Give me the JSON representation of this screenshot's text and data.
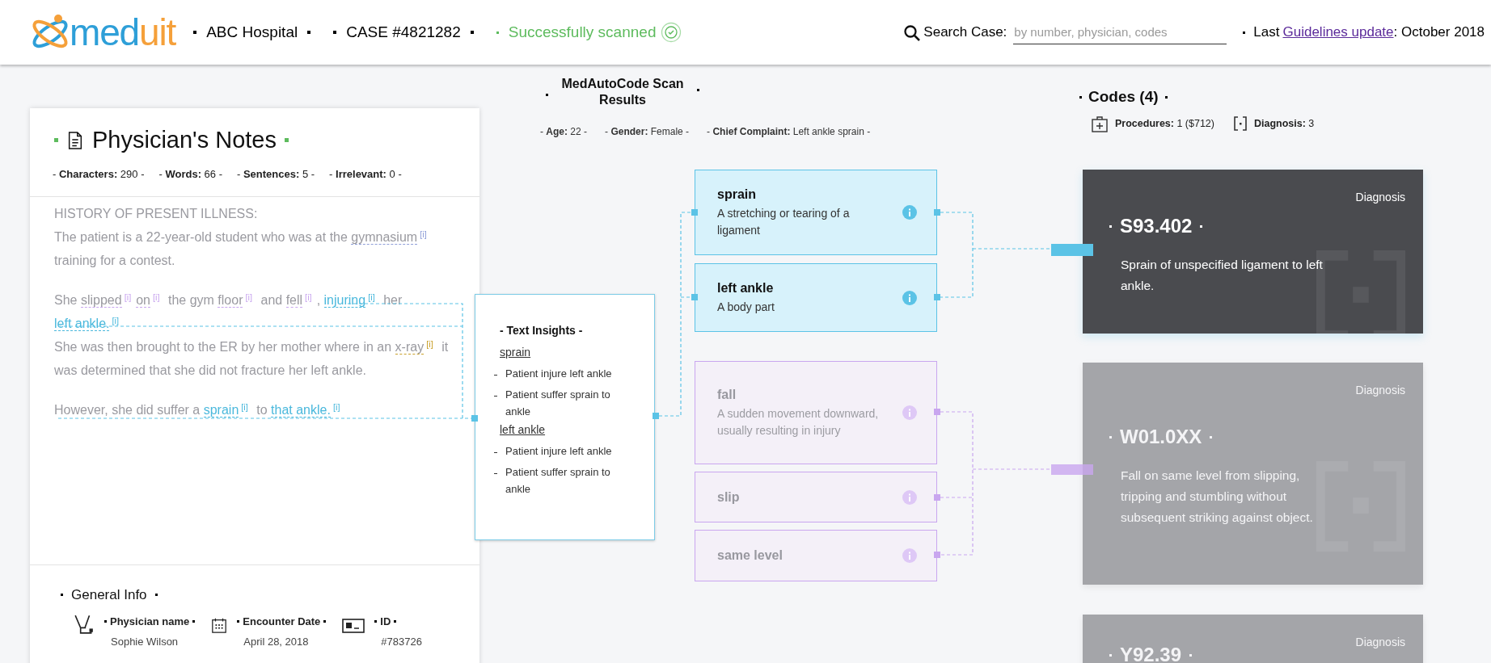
{
  "header": {
    "logo": {
      "parts": [
        "med",
        "uit"
      ]
    },
    "items": [
      {
        "kind": "text",
        "text": "ABC Hospital"
      },
      {
        "kind": "text",
        "text": "CASE #4821282"
      },
      {
        "kind": "status",
        "text": "Successfully scanned"
      }
    ],
    "search": {
      "label": "Search Case:",
      "placeholder": "by number, physician, codes"
    },
    "update": {
      "prefix": "Last",
      "link": "Guidelines update",
      "suffix": ": October 2018"
    }
  },
  "notes": {
    "title": "Physician's Notes",
    "stats": [
      "- **Characters:** 290 -",
      "- **Words:** 66 -",
      "- **Sentences:** 5 -",
      "- **Irrelevant:** 0 -"
    ],
    "groups": [
      [
        [
          {
            "kind": "text",
            "text": "HISTORY OF PRESENT ILLNESS:"
          }
        ],
        [
          {
            "kind": "text",
            "text": "The patient is a 22-year-old student who was at the "
          },
          {
            "kind": "term",
            "text": "gymnasium",
            "marker": "[i]",
            "color": "#8f9fd8",
            "active": false
          },
          {
            "kind": "text",
            "text": " training for a contest."
          }
        ]
      ],
      [
        [
          {
            "kind": "text",
            "text": "She "
          },
          {
            "kind": "term",
            "text": "slipped",
            "marker": "[i]",
            "color": "#c9a6ef",
            "active": false
          },
          {
            "kind": "term",
            "text": "on",
            "marker": "[i]",
            "color": "#c9a6ef",
            "active": false
          },
          {
            "kind": "text",
            "text": " the gym "
          },
          {
            "kind": "term",
            "text": "floor",
            "marker": "[i]",
            "color": "#c9a6ef",
            "active": false
          },
          {
            "kind": "text",
            "text": " and "
          },
          {
            "kind": "term",
            "text": "fell",
            "marker": "[i]",
            "color": "#c9a6ef",
            "active": false
          },
          {
            "kind": "text",
            "text": ", "
          },
          {
            "kind": "term",
            "text": "injuring",
            "marker": "[i]",
            "color": "#4ab8dc",
            "active": true
          },
          {
            "kind": "text",
            "text": " her "
          },
          {
            "kind": "term",
            "text": "left ankle.",
            "marker": "[i]",
            "color": "#4ab8dc",
            "active": true
          }
        ],
        [
          {
            "kind": "text",
            "text": "She was then brought to the ER by her mother where in an "
          },
          {
            "kind": "term",
            "text": "x-ray",
            "marker": "[i]",
            "color": "#c9a02a",
            "active": false
          },
          {
            "kind": "text",
            "text": " it was determined that she did not fracture her left ankle."
          }
        ]
      ],
      [
        [
          {
            "kind": "text",
            "text": "However, she did suffer a "
          },
          {
            "kind": "term",
            "text": "sprain",
            "marker": "[i]",
            "color": "#4ab8dc",
            "active": true
          },
          {
            "kind": "text",
            "text": " to "
          },
          {
            "kind": "term",
            "text": "that ankle.",
            "marker": "[i]",
            "color": "#4ab8dc",
            "active": true
          }
        ]
      ]
    ],
    "general": {
      "title": "General Info",
      "fields": [
        {
          "kind": "physician",
          "label": "Physician name",
          "value": "Sophie Wilson"
        },
        {
          "kind": "date",
          "label": "Encounter Date",
          "value": "April 28, 2018"
        },
        {
          "kind": "id",
          "label": "ID",
          "value": "#783726"
        }
      ]
    }
  },
  "scan": {
    "title": "MedAutoCode Scan Results",
    "info": [
      "- **Age:** 22 -",
      "- **Gender:** Female -",
      "- **Chief Complaint:** Left ankle sprain -"
    ]
  },
  "insights": {
    "title": "- Text Insights -",
    "groups": [
      {
        "term": "sprain",
        "items": [
          "Patient injure left ankle",
          "Patient suffer sprain to ankle"
        ]
      },
      {
        "term": "left ankle",
        "items": [
          "Patient injure left ankle",
          "Patient suffer sprain to ankle"
        ]
      }
    ]
  },
  "terms": [
    {
      "term": "sprain",
      "definition": "A stretching or tearing of a ligament",
      "active": true,
      "color": "#5bc3e6"
    },
    {
      "term": "left ankle",
      "definition": "A body part",
      "active": true,
      "color": "#5bc3e6"
    },
    {
      "term": "fall",
      "definition": "A sudden movement downward, usually resulting in injury",
      "active": false,
      "color": "#c9a6ef"
    },
    {
      "term": "slip",
      "active": false,
      "color": "#c9a6ef"
    },
    {
      "term": "same level",
      "active": false,
      "color": "#c9a6ef"
    }
  ],
  "codes": {
    "title": "Codes (4)",
    "summary": [
      {
        "kind": "procedures",
        "text": "**Procedures:** 1 ($712)"
      },
      {
        "kind": "diagnosis",
        "text": "**Diagnosis:** 3"
      }
    ],
    "cards": [
      {
        "type": "Diagnosis",
        "code": "S93.402",
        "description": "Sprain of unspecified ligament to left ankle.",
        "active": true
      },
      {
        "type": "Diagnosis",
        "code": "W01.0XX",
        "description": "Fall on same level from slipping, tripping and stumbling without subsequent striking against object.",
        "active": false
      },
      {
        "type": "Diagnosis",
        "code": "Y92.39",
        "active": false
      }
    ]
  }
}
